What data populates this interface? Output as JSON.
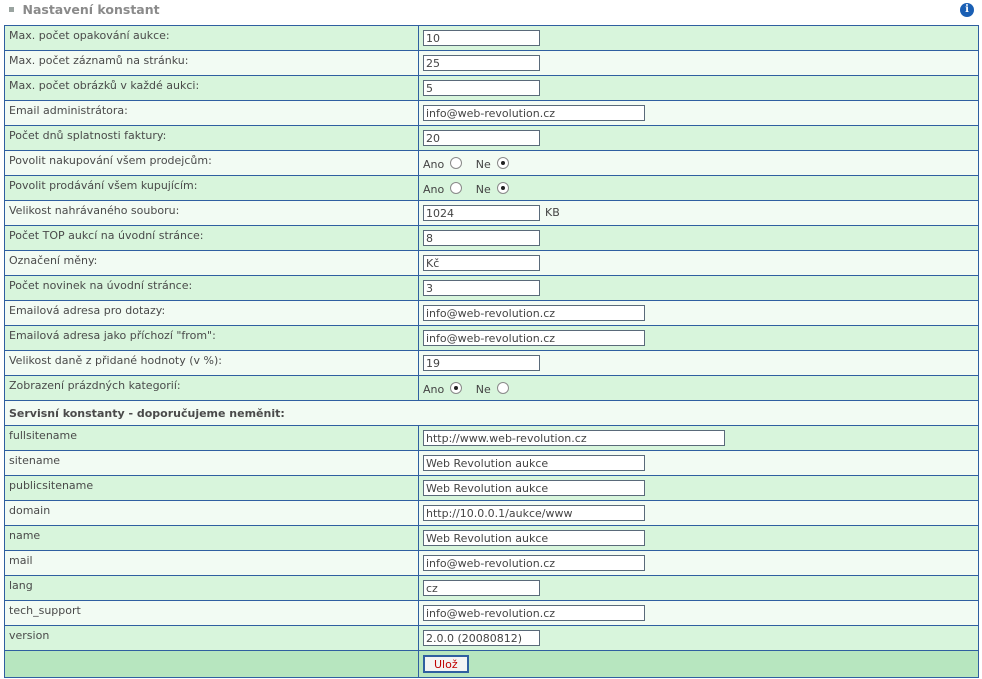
{
  "header": {
    "title": "Nastavení konstant",
    "info_icon": "info-icon"
  },
  "rows": [
    {
      "label": "Max. počet opakování aukce:",
      "value": "10"
    },
    {
      "label": "Max. počet záznamů na stránku:",
      "value": "25"
    },
    {
      "label": "Max. počet obrázků v každé aukci:",
      "value": "5"
    },
    {
      "label": "Email administrátora:",
      "value": "info@web-revolution.cz"
    },
    {
      "label": "Počet dnů splatnosti faktury:",
      "value": "20"
    },
    {
      "label": "Povolit nakupování všem prodejcům:",
      "yes": "Ano",
      "no": "Ne",
      "selected": "no"
    },
    {
      "label": "Povolit prodávání všem kupujícím:",
      "yes": "Ano",
      "no": "Ne",
      "selected": "no"
    },
    {
      "label": "Velikost nahrávaného souboru:",
      "value": "1024",
      "unit": "KB"
    },
    {
      "label": "Počet TOP aukcí na úvodní stránce:",
      "value": "8"
    },
    {
      "label": "Označení měny:",
      "value": "Kč"
    },
    {
      "label": "Počet novinek na úvodní stránce:",
      "value": "3"
    },
    {
      "label": "Emailová adresa pro dotazy:",
      "value": "info@web-revolution.cz"
    },
    {
      "label": "Emailová adresa jako příchozí \"from\":",
      "value": "info@web-revolution.cz"
    },
    {
      "label": "Velikost daně z přidané hodnoty (v %):",
      "value": "19"
    },
    {
      "label": "Zobrazení prázdných kategorií:",
      "yes": "Ano",
      "no": "Ne",
      "selected": "yes"
    }
  ],
  "section_title": "Servisní konstanty - doporučujeme neměnit:",
  "service": [
    {
      "label": "fullsitename",
      "value": "http://www.web-revolution.cz"
    },
    {
      "label": "sitename",
      "value": "Web Revolution aukce"
    },
    {
      "label": "publicsitename",
      "value": "Web Revolution aukce"
    },
    {
      "label": "domain",
      "value": "http://10.0.0.1/aukce/www"
    },
    {
      "label": "name",
      "value": "Web Revolution aukce"
    },
    {
      "label": "mail",
      "value": "info@web-revolution.cz"
    },
    {
      "label": "lang",
      "value": "cz"
    },
    {
      "label": "tech_support",
      "value": "info@web-revolution.cz"
    },
    {
      "label": "version",
      "value": "2.0.0 (20080812)"
    }
  ],
  "save_label": "Ulož",
  "colors": {
    "row_odd": "#d8f5dc",
    "row_even": "#f2fbf3",
    "border": "#2f5fa0",
    "submit_row": "#b7e6bf",
    "save_text": "#c00000"
  }
}
